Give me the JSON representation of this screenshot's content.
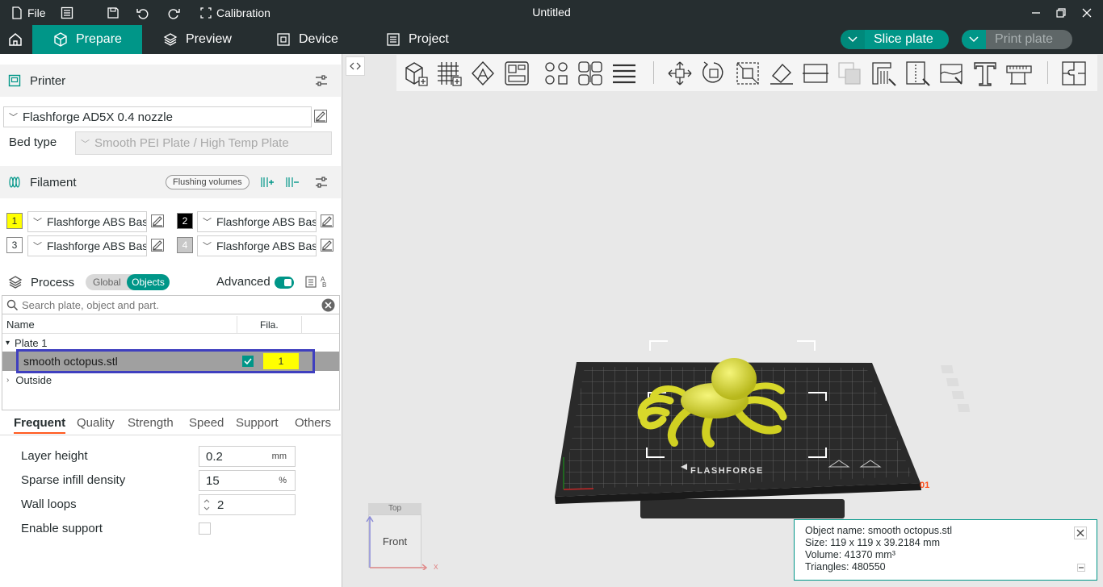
{
  "titlebar": {
    "file_label": "File",
    "calibration_label": "Calibration",
    "window_title": "Untitled"
  },
  "tabs": {
    "prepare": "Prepare",
    "preview": "Preview",
    "device": "Device",
    "project": "Project",
    "slice_plate": "Slice plate",
    "print_plate": "Print plate"
  },
  "printer": {
    "section_title": "Printer",
    "selected_printer": "Flashforge AD5X 0.4 nozzle",
    "bed_type_label": "Bed type",
    "bed_type_value": "Smooth PEI Plate / High Temp Plate"
  },
  "filament": {
    "section_title": "Filament",
    "flushing_volumes_label": "Flushing volumes",
    "slots": [
      {
        "number": "1",
        "name": "Flashforge ABS Basic",
        "color": "#ffff00",
        "text_color": "#262e30"
      },
      {
        "number": "2",
        "name": "Flashforge ABS Basic",
        "color": "#000000",
        "text_color": "#ffffff"
      },
      {
        "number": "3",
        "name": "Flashforge ABS Basic",
        "color": "#ffffff",
        "text_color": "#262e30"
      },
      {
        "number": "4",
        "name": "Flashforge ABS Basic",
        "color": "#c8c8c8",
        "text_color": "#ffffff"
      }
    ]
  },
  "process": {
    "section_title": "Process",
    "toggle_global": "Global",
    "toggle_objects": "Objects",
    "advanced_label": "Advanced",
    "search_placeholder": "Search plate, object and part."
  },
  "object_list": {
    "col_name": "Name",
    "col_fila": "Fila.",
    "plate_label": "Plate 1",
    "object_name": "smooth octopus.stl",
    "object_filament": "1",
    "outside_label": "Outside"
  },
  "param_tabs": [
    "Frequent",
    "Quality",
    "Strength",
    "Speed",
    "Support",
    "Others"
  ],
  "params": {
    "layer_height_label": "Layer height",
    "layer_height_value": "0.2",
    "layer_height_unit": "mm",
    "sparse_infill_label": "Sparse infill density",
    "sparse_infill_value": "15",
    "sparse_infill_unit": "%",
    "wall_loops_label": "Wall loops",
    "wall_loops_value": "2",
    "enable_support_label": "Enable support"
  },
  "viewport": {
    "collapse_icon": "collapse-sidebar-icon",
    "view_cube_front": "Front",
    "view_cube_top": "Top",
    "axis_x_label": "x",
    "plate_brand": "FLASHFORGE",
    "plate_number": "01"
  },
  "object_info": {
    "name_line": "Object name: smooth octopus.stl",
    "size_line": "Size: 119 x 119 x 39.2184 mm",
    "volume_line": "Volume: 41370 mm³",
    "triangles_line": "Triangles: 480550"
  },
  "colors": {
    "accent": "#009688",
    "titlebar_bg": "#262e30",
    "selection_outline": "#3f3fbf",
    "model_yellow": "#e6e633"
  }
}
